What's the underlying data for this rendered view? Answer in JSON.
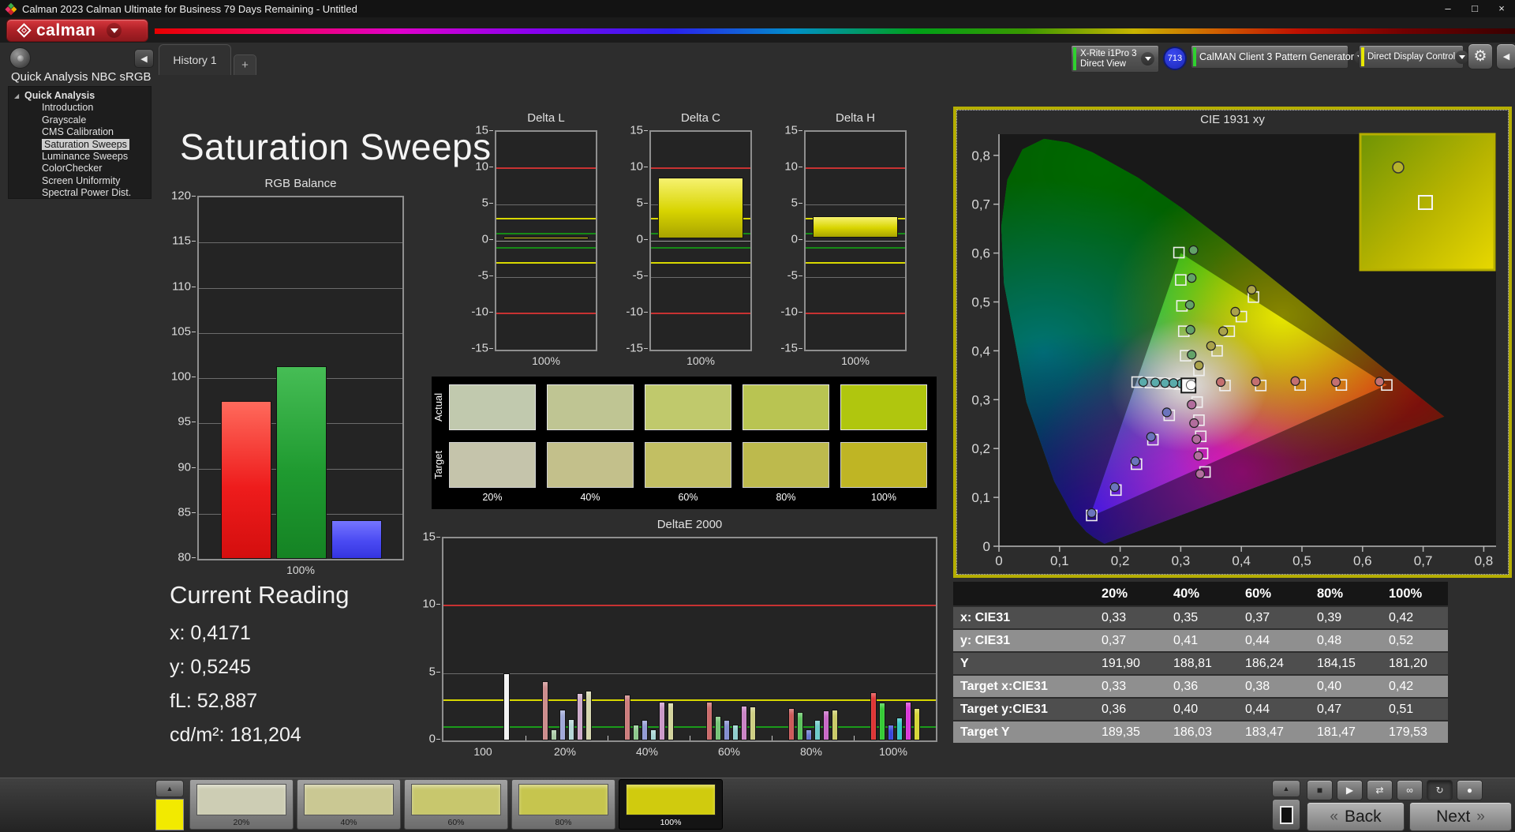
{
  "window": {
    "title": "Calman 2023 Calman Ultimate for Business 79 Days Remaining  - Untitled"
  },
  "icons": {
    "minimize": "–",
    "maximize": "□",
    "close": "×",
    "dropdown": "▼",
    "gear": "⚙",
    "collapse_left": "◀",
    "tree_expanded": "◢",
    "plus": "+",
    "up_chevron": "▲",
    "back_chevrons": "«",
    "next_chevrons": "»"
  },
  "menubar": {
    "logo_text": "calman"
  },
  "tabs": {
    "history_label": "History 1",
    "add_label": "+"
  },
  "top_controls": {
    "meter": {
      "line1": "X-Rite i1Pro 3",
      "line2": "Direct View",
      "status_color": "#2fd12f"
    },
    "badge": "713",
    "source": {
      "label": "CalMAN Client 3 Pattern Generator",
      "status_color": "#2fd12f"
    },
    "display_control": {
      "label": "Direct Display Control",
      "status_color": "#e8e800"
    }
  },
  "sidebar": {
    "header": "Quick Analysis NBC sRGB",
    "tree": [
      {
        "label": "Quick Analysis",
        "level": 0,
        "bold": true,
        "expanded": true
      },
      {
        "label": "Introduction",
        "level": 1
      },
      {
        "label": "Grayscale",
        "level": 1
      },
      {
        "label": "CMS Calibration",
        "level": 1
      },
      {
        "label": "Saturation Sweeps",
        "level": 1,
        "selected": true
      },
      {
        "label": "Luminance Sweeps",
        "level": 1
      },
      {
        "label": "ColorChecker",
        "level": 1
      },
      {
        "label": "Screen Uniformity",
        "level": 1
      },
      {
        "label": "Spectral Power Dist.",
        "level": 1
      }
    ]
  },
  "page": {
    "title": "Saturation Sweeps"
  },
  "current_reading": {
    "title": "Current Reading",
    "lines": [
      "x: 0,4171",
      "y: 0,5245",
      "fL: 52,887",
      "cd/m²: 181,204"
    ]
  },
  "swatches": {
    "row_labels": [
      "Actual",
      "Target"
    ],
    "col_labels": [
      "20%",
      "40%",
      "60%",
      "80%",
      "100%"
    ],
    "actual_colors": [
      "#c1c9ae",
      "#bfc593",
      "#c0c96c",
      "#b9c452",
      "#b0c60e"
    ],
    "target_colors": [
      "#c5c4ab",
      "#c3c08b",
      "#c2bf63",
      "#bdba4d",
      "#bfb524"
    ]
  },
  "chart_data": {
    "rgb_balance": {
      "type": "bar",
      "title": "RGB Balance",
      "xlabel": "100%",
      "categories": [
        "Red",
        "Green",
        "Blue"
      ],
      "values": [
        97.5,
        101.3,
        84.3
      ],
      "colors": [
        "#ee1c1c",
        "#1f9a30",
        "#4a4af2"
      ],
      "ylim": [
        80,
        120
      ],
      "yticks": [
        120,
        115,
        110,
        105,
        100,
        95,
        90,
        85,
        80
      ]
    },
    "delta_l": {
      "type": "bar",
      "title": "Delta L",
      "xlabel": "100%",
      "ylim": [
        -15,
        15
      ],
      "yticks": [
        15,
        10,
        5,
        0,
        -5,
        -10,
        -15
      ],
      "ref_lines": [
        {
          "value": 10,
          "color": "#c83232"
        },
        {
          "value": -10,
          "color": "#c83232"
        },
        {
          "value": 3,
          "color": "#d8d800"
        },
        {
          "value": -3,
          "color": "#d8d800"
        },
        {
          "value": 1,
          "color": "#178a17"
        },
        {
          "value": -1,
          "color": "#178a17"
        }
      ],
      "bar": {
        "from": 0.2,
        "to": 0.5
      }
    },
    "delta_c": {
      "type": "bar",
      "title": "Delta C",
      "xlabel": "100%",
      "ylim": [
        -15,
        15
      ],
      "yticks": [
        15,
        10,
        5,
        0,
        -5,
        -10,
        -15
      ],
      "ref_lines": [
        {
          "value": 10,
          "color": "#c83232"
        },
        {
          "value": -10,
          "color": "#c83232"
        },
        {
          "value": 3,
          "color": "#d8d800"
        },
        {
          "value": -3,
          "color": "#d8d800"
        },
        {
          "value": 1,
          "color": "#178a17"
        },
        {
          "value": -1,
          "color": "#178a17"
        }
      ],
      "bar": {
        "from": 0.35,
        "to": 8.7
      }
    },
    "delta_h": {
      "type": "bar",
      "title": "Delta H",
      "xlabel": "100%",
      "ylim": [
        -15,
        15
      ],
      "yticks": [
        15,
        10,
        5,
        0,
        -5,
        -10,
        -15
      ],
      "ref_lines": [
        {
          "value": 10,
          "color": "#c83232"
        },
        {
          "value": -10,
          "color": "#c83232"
        },
        {
          "value": 3,
          "color": "#d8d800"
        },
        {
          "value": -3,
          "color": "#d8d800"
        },
        {
          "value": 1,
          "color": "#178a17"
        },
        {
          "value": -1,
          "color": "#178a17"
        }
      ],
      "bar": {
        "from": 0.45,
        "to": 3.4
      }
    },
    "deltae_2000": {
      "type": "grouped-bar",
      "title": "DeltaE 2000",
      "ylim": [
        0,
        15
      ],
      "yticks": [
        15,
        10,
        5,
        0
      ],
      "ref_lines": [
        {
          "value": 10,
          "color": "#c83232"
        },
        {
          "value": 3,
          "color": "#d8d800"
        },
        {
          "value": 1,
          "color": "#1a9a1a"
        }
      ],
      "groups": [
        {
          "label": "100",
          "values": [
            null,
            null,
            null,
            null,
            null,
            5.0
          ],
          "colors": [
            null,
            null,
            null,
            null,
            null,
            "#f2f2f2"
          ]
        },
        {
          "label": "20%",
          "values": [
            4.4,
            0.8,
            2.3,
            1.6,
            3.5,
            3.7
          ],
          "colors": [
            "#c98383",
            "#9fc49a",
            "#99a2d6",
            "#aed3d3",
            "#c9a3c6",
            "#d3d3a8"
          ]
        },
        {
          "label": "40%",
          "values": [
            3.4,
            1.2,
            1.5,
            0.8,
            2.9,
            2.8
          ],
          "colors": [
            "#c97272",
            "#84c484",
            "#8a92d2",
            "#9cd0d0",
            "#c790c4",
            "#cfcf94"
          ]
        },
        {
          "label": "60%",
          "values": [
            2.9,
            1.8,
            1.5,
            1.2,
            2.6,
            2.5
          ],
          "colors": [
            "#c96060",
            "#6cc06c",
            "#7a84cd",
            "#86caca",
            "#c67ac2",
            "#caca7a"
          ]
        },
        {
          "label": "80%",
          "values": [
            2.4,
            2.1,
            0.8,
            1.5,
            2.2,
            2.3
          ],
          "colors": [
            "#c94d4d",
            "#50bd50",
            "#5a6aca",
            "#62c6c6",
            "#c55cc2",
            "#c6c65a"
          ]
        },
        {
          "label": "100%",
          "values": [
            3.6,
            2.8,
            1.2,
            1.7,
            2.9,
            2.4
          ],
          "colors": [
            "#dd2525",
            "#25c825",
            "#2a39da",
            "#26c2c2",
            "#d828d8",
            "#d2d226"
          ]
        }
      ]
    },
    "cie_1931": {
      "type": "scatter",
      "title": "CIE 1931 xy",
      "xlim": [
        0,
        0.8
      ],
      "ylim": [
        0,
        0.8
      ],
      "xtick_labels": [
        "0",
        "0,1",
        "0,2",
        "0,3",
        "0,4",
        "0,5",
        "0,6",
        "0,7",
        "0,8"
      ],
      "ytick_labels": [
        "0",
        "0,1",
        "0,2",
        "0,3",
        "0,4",
        "0,5",
        "0,6",
        "0,7",
        "0,8"
      ],
      "gamut_triangle": [
        [
          0.64,
          0.33
        ],
        [
          0.3,
          0.6
        ],
        [
          0.15,
          0.06
        ]
      ],
      "white_point": {
        "target": [
          0.3127,
          0.329
        ],
        "measured": [
          0.317,
          0.33
        ]
      },
      "sweeps": [
        {
          "name": "red",
          "color": "#c47070",
          "targets": [
            [
              0.373,
              0.329
            ],
            [
              0.432,
              0.329
            ],
            [
              0.497,
              0.33
            ],
            [
              0.565,
              0.33
            ],
            [
              0.64,
              0.33
            ]
          ],
          "measured": [
            [
              0.366,
              0.336
            ],
            [
              0.424,
              0.337
            ],
            [
              0.489,
              0.338
            ],
            [
              0.556,
              0.336
            ],
            [
              0.628,
              0.337
            ]
          ]
        },
        {
          "name": "green",
          "color": "#63a268",
          "targets": [
            [
              0.308,
              0.39
            ],
            [
              0.305,
              0.44
            ],
            [
              0.302,
              0.492
            ],
            [
              0.3,
              0.545
            ],
            [
              0.297,
              0.601
            ]
          ],
          "measured": [
            [
              0.318,
              0.392
            ],
            [
              0.316,
              0.443
            ],
            [
              0.315,
              0.494
            ],
            [
              0.318,
              0.549
            ],
            [
              0.321,
              0.606
            ]
          ]
        },
        {
          "name": "blue",
          "color": "#6b74bd",
          "targets": [
            [
              0.281,
              0.268
            ],
            [
              0.254,
              0.218
            ],
            [
              0.227,
              0.168
            ],
            [
              0.193,
              0.115
            ],
            [
              0.153,
              0.063
            ]
          ],
          "measured": [
            [
              0.277,
              0.274
            ],
            [
              0.251,
              0.224
            ],
            [
              0.225,
              0.174
            ],
            [
              0.191,
              0.121
            ],
            [
              0.153,
              0.068
            ]
          ]
        },
        {
          "name": "cyan",
          "color": "#5aabab",
          "targets": [
            [
              0.298,
              0.332
            ],
            [
              0.283,
              0.333
            ],
            [
              0.268,
              0.334
            ],
            [
              0.25,
              0.335
            ],
            [
              0.228,
              0.336
            ]
          ],
          "measured": [
            [
              0.301,
              0.333
            ],
            [
              0.288,
              0.334
            ],
            [
              0.274,
              0.334
            ],
            [
              0.258,
              0.335
            ],
            [
              0.238,
              0.336
            ]
          ]
        },
        {
          "name": "magenta",
          "color": "#b26d9d",
          "targets": [
            [
              0.327,
              0.295
            ],
            [
              0.33,
              0.258
            ],
            [
              0.333,
              0.225
            ],
            [
              0.336,
              0.19
            ],
            [
              0.34,
              0.152
            ]
          ],
          "measured": [
            [
              0.318,
              0.29
            ],
            [
              0.322,
              0.252
            ],
            [
              0.326,
              0.219
            ],
            [
              0.329,
              0.185
            ],
            [
              0.332,
              0.148
            ]
          ]
        },
        {
          "name": "yellow",
          "color": "#aaa24b",
          "targets": [
            [
              0.33,
              0.36
            ],
            [
              0.36,
              0.4
            ],
            [
              0.38,
              0.44
            ],
            [
              0.4,
              0.47
            ],
            [
              0.42,
              0.51
            ]
          ],
          "measured": [
            [
              0.33,
              0.37
            ],
            [
              0.35,
              0.41
            ],
            [
              0.37,
              0.44
            ],
            [
              0.39,
              0.48
            ],
            [
              0.417,
              0.525
            ]
          ]
        }
      ]
    }
  },
  "table": {
    "headers": [
      "20%",
      "40%",
      "60%",
      "80%",
      "100%"
    ],
    "rows": [
      {
        "label": "x: CIE31",
        "values": [
          "0,33",
          "0,35",
          "0,37",
          "0,39",
          "0,42"
        ]
      },
      {
        "label": "y: CIE31",
        "values": [
          "0,37",
          "0,41",
          "0,44",
          "0,48",
          "0,52"
        ]
      },
      {
        "label": "Y",
        "values": [
          "191,90",
          "188,81",
          "186,24",
          "184,15",
          "181,20"
        ]
      },
      {
        "label": "Target x:CIE31",
        "values": [
          "0,33",
          "0,36",
          "0,38",
          "0,40",
          "0,42"
        ]
      },
      {
        "label": "Target y:CIE31",
        "values": [
          "0,36",
          "0,40",
          "0,44",
          "0,47",
          "0,51"
        ]
      },
      {
        "label": "Target Y",
        "values": [
          "189,35",
          "186,03",
          "183,47",
          "181,47",
          "179,53"
        ]
      }
    ]
  },
  "bottombar": {
    "patterns": [
      {
        "label": "20%",
        "color": "#cdcdb4"
      },
      {
        "label": "40%",
        "color": "#cac893"
      },
      {
        "label": "60%",
        "color": "#c8c76d"
      },
      {
        "label": "80%",
        "color": "#c6c54e"
      },
      {
        "label": "100%",
        "color": "#d0cb0e",
        "selected": true
      }
    ],
    "transport": [
      {
        "name": "stop-button",
        "glyph": "■"
      },
      {
        "name": "play-button",
        "glyph": "▶"
      },
      {
        "name": "skip-button",
        "glyph": "⇄"
      },
      {
        "name": "loop-button",
        "glyph": "∞"
      },
      {
        "name": "refresh-button",
        "glyph": "↻",
        "pressed": true
      },
      {
        "name": "record-button",
        "glyph": "●"
      }
    ],
    "back_label": "Back",
    "next_label": "Next"
  }
}
